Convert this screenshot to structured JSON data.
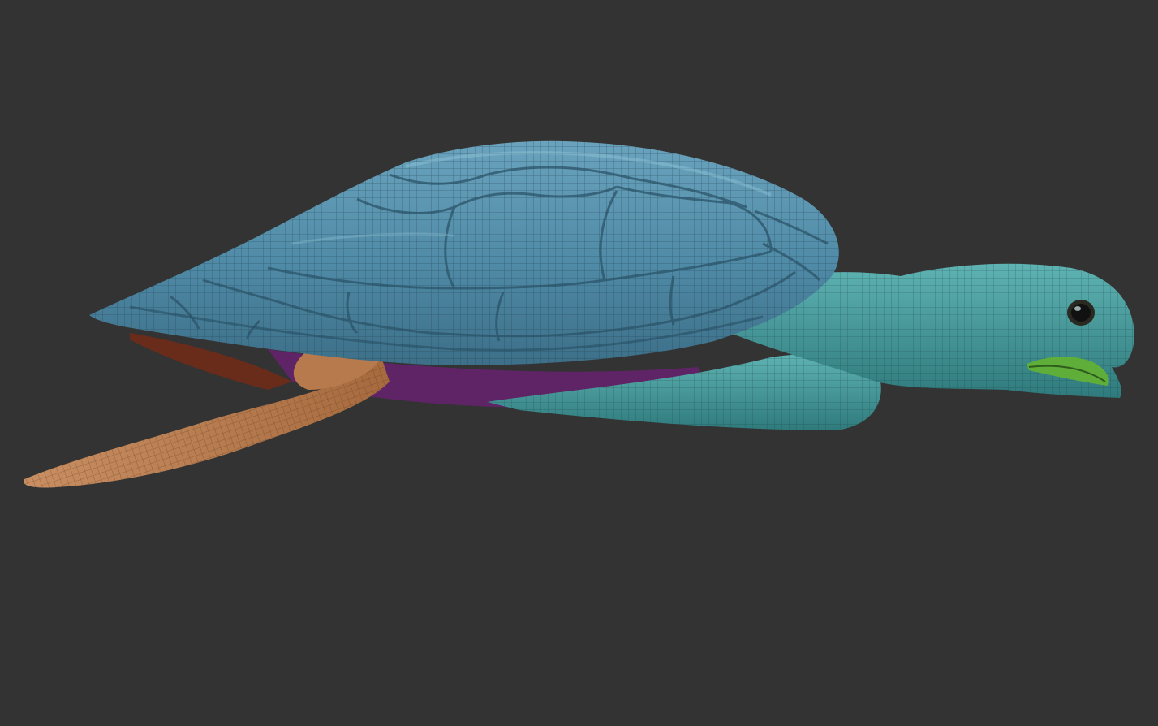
{
  "scene": {
    "subject_icon": "sea-turtle-wireframe-model",
    "colors": {
      "background": "#333333",
      "carapace": "#4f8aa6",
      "carapace_light": "#7fb6cc",
      "skin": "#3f8f92",
      "skin_light": "#6fc0bf",
      "rear_flipper": "#c0865a",
      "rear_flipper_dark": "#7a4a2a",
      "underside": "#6a2a70",
      "mouth": "#5fae3a",
      "eye": "#1a1a1a",
      "wire": "#1d3b48"
    }
  }
}
